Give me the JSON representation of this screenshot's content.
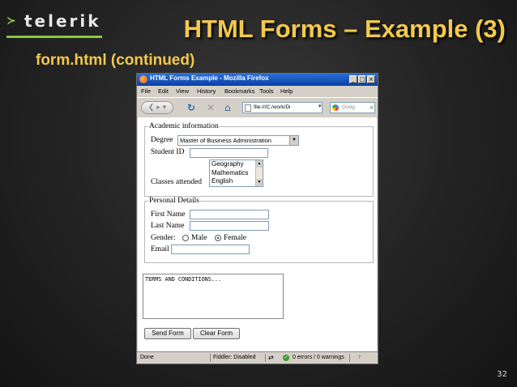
{
  "slide": {
    "logo_text": "telerik",
    "logo_mark": "≻",
    "title": "HTML Forms – Example (3)",
    "subtitle": "form.html (continued)",
    "page_number": "32"
  },
  "browser": {
    "window_title": "HTML Forms Example - Mozilla Firefox",
    "window_buttons": [
      "_",
      "□",
      "×"
    ],
    "menu": [
      "File",
      "Edit",
      "View",
      "History",
      "Bookmarks",
      "Tools",
      "Help"
    ],
    "url": "file:///C:/work/Di",
    "search_placeholder": "Goog",
    "status": {
      "left": "Done",
      "fiddler": "Fiddler: Disabled",
      "errors": "0 errors / 0 warnings"
    }
  },
  "form": {
    "academic": {
      "legend": "Academic information",
      "degree_label": "Degree",
      "degree_value": "Master of Business Administration",
      "student_id_label": "Student ID",
      "student_id_value": "",
      "classes_label": "Classes attended",
      "classes_options": [
        "Geography",
        "Mathematics",
        "English"
      ]
    },
    "personal": {
      "legend": "Personal Details",
      "first_name_label": "First Name",
      "first_name_value": "",
      "last_name_label": "Last Name",
      "last_name_value": "",
      "gender_label": "Gender:",
      "gender_male": "Male",
      "gender_female": "Female",
      "gender_selected": "Female",
      "email_label": "Email",
      "email_value": ""
    },
    "terms_text": "TERMS AND CONDITIONS...",
    "send_button": "Send Form",
    "clear_button": "Clear Form"
  },
  "icons": [
    "back-forward-icon",
    "reload-icon",
    "stop-icon",
    "home-icon",
    "page-icon",
    "google-icon",
    "search-icon",
    "check-icon",
    "firefox-icon"
  ],
  "colors": {
    "title": "#f2c94c",
    "accent": "#8cc63f",
    "titlebar": "#0a3fa5"
  }
}
